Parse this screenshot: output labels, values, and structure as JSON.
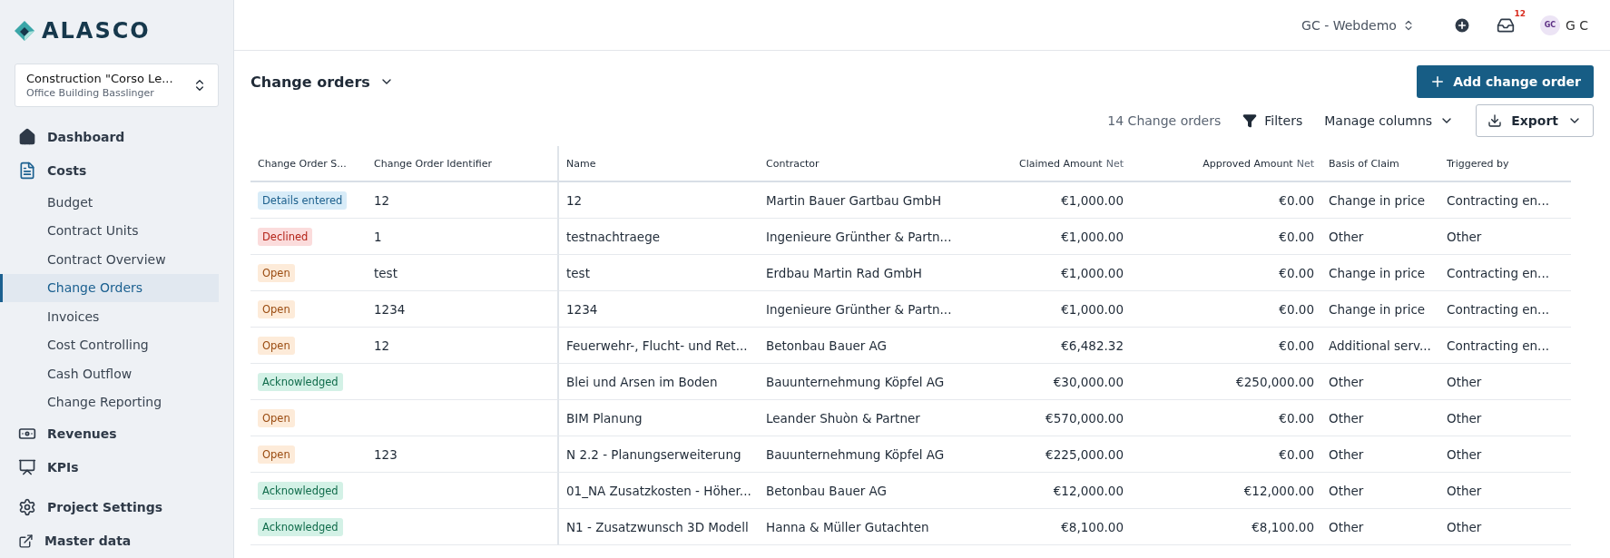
{
  "brand": "ALASCO",
  "project": {
    "title": "Construction \"Corso Le...",
    "subtitle": "Office Building Basslinger"
  },
  "nav": [
    {
      "label": "Dashboard",
      "selected": false
    },
    {
      "label": "Costs",
      "selected": false,
      "children": [
        {
          "label": "Budget",
          "selected": false
        },
        {
          "label": "Contract Units",
          "selected": false
        },
        {
          "label": "Contract Overview",
          "selected": false
        },
        {
          "label": "Change Orders",
          "selected": true
        },
        {
          "label": "Invoices",
          "selected": false
        },
        {
          "label": "Cost Controlling",
          "selected": false
        },
        {
          "label": "Cash Outflow",
          "selected": false
        },
        {
          "label": "Change Reporting",
          "selected": false
        }
      ]
    },
    {
      "label": "Revenues",
      "selected": false
    },
    {
      "label": "KPIs",
      "selected": false
    },
    {
      "label": "Project Settings",
      "selected": false
    },
    {
      "label": "Master data",
      "selected": false
    }
  ],
  "topbar": {
    "workspace": "GC - Webdemo",
    "notifications": "12",
    "avatar": "GC",
    "user": "G C"
  },
  "page": {
    "title": "Change orders",
    "add_button": "Add change order",
    "count": "14 Change orders",
    "filters": "Filters",
    "manage_columns": "Manage columns",
    "export": "Export"
  },
  "table": {
    "columns": [
      {
        "label": "Change Order S..."
      },
      {
        "label": "Change Order Identifier"
      },
      {
        "label": "Name"
      },
      {
        "label": "Contractor"
      },
      {
        "label": "Claimed Amount",
        "suffix": "Net"
      },
      {
        "label": "Approved Amount",
        "suffix": "Net"
      },
      {
        "label": "Basis of Claim"
      },
      {
        "label": "Triggered by"
      }
    ],
    "rows": [
      {
        "kind": "details",
        "cells": [
          "Details entered",
          "12",
          "12",
          "Martin Bauer Gartbau GmbH",
          "€1,000.00",
          "€0.00",
          "Change in price",
          "Contracting en..."
        ]
      },
      {
        "kind": "declined",
        "cells": [
          "Declined",
          "1",
          "testnachtraege",
          "Ingenieure Grünther & Partn...",
          "€1,000.00",
          "€0.00",
          "Other",
          "Other"
        ]
      },
      {
        "kind": "open",
        "cells": [
          "Open",
          "test",
          "test",
          "Erdbau Martin Rad GmbH",
          "€1,000.00",
          "€0.00",
          "Change in price",
          "Contracting en..."
        ]
      },
      {
        "kind": "open",
        "cells": [
          "Open",
          "1234",
          "1234",
          "Ingenieure Grünther & Partn...",
          "€1,000.00",
          "€0.00",
          "Change in price",
          "Contracting en..."
        ]
      },
      {
        "kind": "open",
        "cells": [
          "Open",
          "12",
          "Feuerwehr-, Flucht- und Ret...",
          "Betonbau Bauer AG",
          "€6,482.32",
          "€0.00",
          "Additional serv...",
          "Contracting en..."
        ]
      },
      {
        "kind": "acknowledged",
        "cells": [
          "Acknowledged",
          "",
          "Blei und Arsen im Boden",
          "Bauunternehmung Köpfel AG",
          "€30,000.00",
          "€250,000.00",
          "Other",
          "Other"
        ]
      },
      {
        "kind": "open",
        "cells": [
          "Open",
          "",
          "BIM Planung",
          "Leander Shuòn & Partner",
          "€570,000.00",
          "€0.00",
          "Other",
          "Other"
        ]
      },
      {
        "kind": "open",
        "cells": [
          "Open",
          "123",
          "N 2.2 - Planungserweiterung",
          "Bauunternehmung Köpfel AG",
          "€225,000.00",
          "€0.00",
          "Other",
          "Other"
        ]
      },
      {
        "kind": "acknowledged",
        "cells": [
          "Acknowledged",
          "",
          "01_NA Zusatzkosten - Höher...",
          "Betonbau Bauer AG",
          "€12,000.00",
          "€12,000.00",
          "Other",
          "Other"
        ]
      },
      {
        "kind": "acknowledged",
        "cells": [
          "Acknowledged",
          "",
          "N1 - Zusatzwunsch 3D Modell",
          "Hanna & Müller Gutachten",
          "€8,100.00",
          "€8,100.00",
          "Other",
          "Other"
        ]
      }
    ]
  }
}
